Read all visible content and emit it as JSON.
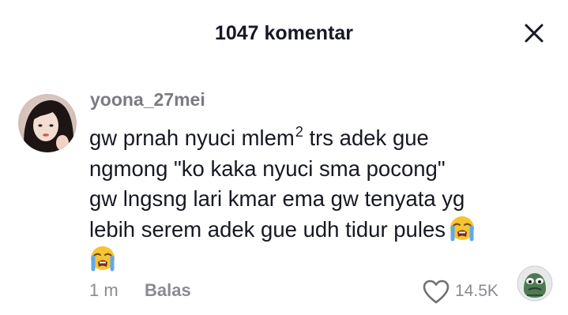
{
  "header": {
    "title": "1047 komentar",
    "close_icon": "close-icon"
  },
  "comment": {
    "username": "yoona_27mei",
    "avatar_icon": "user-avatar",
    "lines": [
      {
        "text": "gw prnah nyuci mlem",
        "sup": "2",
        "tail": " trs adek gue"
      },
      {
        "text": "ngmong \"ko kaka nyuci sma pocong\""
      },
      {
        "text": "gw lngsng lari kmar ema gw tenyata yg"
      },
      {
        "text": "lebih serem adek gue udh tidur pules"
      }
    ],
    "emojis": [
      "loudly-crying-face-emoji",
      "loudly-crying-face-emoji"
    ],
    "time": "1 m",
    "reply_label": "Balas",
    "like_icon": "heart-outline-icon",
    "like_count": "14.5K",
    "sticker_icon": "frog-sticker-icon"
  },
  "colors": {
    "text": "#161823",
    "secondary": "#8a8b91",
    "username": "#7a7b82",
    "emoji_face": "#f6c431"
  }
}
